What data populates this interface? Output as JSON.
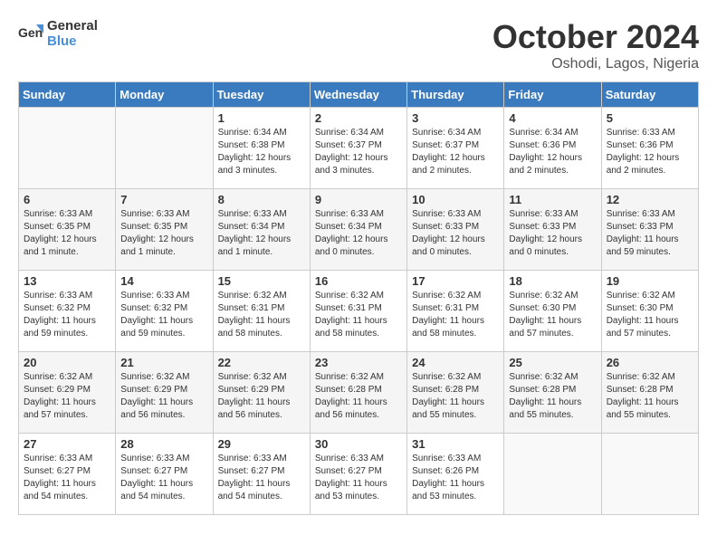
{
  "header": {
    "logo_line1": "General",
    "logo_line2": "Blue",
    "month": "October 2024",
    "location": "Oshodi, Lagos, Nigeria"
  },
  "days_of_week": [
    "Sunday",
    "Monday",
    "Tuesday",
    "Wednesday",
    "Thursday",
    "Friday",
    "Saturday"
  ],
  "weeks": [
    [
      {
        "day": "",
        "info": ""
      },
      {
        "day": "",
        "info": ""
      },
      {
        "day": "1",
        "info": "Sunrise: 6:34 AM\nSunset: 6:38 PM\nDaylight: 12 hours\nand 3 minutes."
      },
      {
        "day": "2",
        "info": "Sunrise: 6:34 AM\nSunset: 6:37 PM\nDaylight: 12 hours\nand 3 minutes."
      },
      {
        "day": "3",
        "info": "Sunrise: 6:34 AM\nSunset: 6:37 PM\nDaylight: 12 hours\nand 2 minutes."
      },
      {
        "day": "4",
        "info": "Sunrise: 6:34 AM\nSunset: 6:36 PM\nDaylight: 12 hours\nand 2 minutes."
      },
      {
        "day": "5",
        "info": "Sunrise: 6:33 AM\nSunset: 6:36 PM\nDaylight: 12 hours\nand 2 minutes."
      }
    ],
    [
      {
        "day": "6",
        "info": "Sunrise: 6:33 AM\nSunset: 6:35 PM\nDaylight: 12 hours\nand 1 minute."
      },
      {
        "day": "7",
        "info": "Sunrise: 6:33 AM\nSunset: 6:35 PM\nDaylight: 12 hours\nand 1 minute."
      },
      {
        "day": "8",
        "info": "Sunrise: 6:33 AM\nSunset: 6:34 PM\nDaylight: 12 hours\nand 1 minute."
      },
      {
        "day": "9",
        "info": "Sunrise: 6:33 AM\nSunset: 6:34 PM\nDaylight: 12 hours\nand 0 minutes."
      },
      {
        "day": "10",
        "info": "Sunrise: 6:33 AM\nSunset: 6:33 PM\nDaylight: 12 hours\nand 0 minutes."
      },
      {
        "day": "11",
        "info": "Sunrise: 6:33 AM\nSunset: 6:33 PM\nDaylight: 12 hours\nand 0 minutes."
      },
      {
        "day": "12",
        "info": "Sunrise: 6:33 AM\nSunset: 6:33 PM\nDaylight: 11 hours\nand 59 minutes."
      }
    ],
    [
      {
        "day": "13",
        "info": "Sunrise: 6:33 AM\nSunset: 6:32 PM\nDaylight: 11 hours\nand 59 minutes."
      },
      {
        "day": "14",
        "info": "Sunrise: 6:33 AM\nSunset: 6:32 PM\nDaylight: 11 hours\nand 59 minutes."
      },
      {
        "day": "15",
        "info": "Sunrise: 6:32 AM\nSunset: 6:31 PM\nDaylight: 11 hours\nand 58 minutes."
      },
      {
        "day": "16",
        "info": "Sunrise: 6:32 AM\nSunset: 6:31 PM\nDaylight: 11 hours\nand 58 minutes."
      },
      {
        "day": "17",
        "info": "Sunrise: 6:32 AM\nSunset: 6:31 PM\nDaylight: 11 hours\nand 58 minutes."
      },
      {
        "day": "18",
        "info": "Sunrise: 6:32 AM\nSunset: 6:30 PM\nDaylight: 11 hours\nand 57 minutes."
      },
      {
        "day": "19",
        "info": "Sunrise: 6:32 AM\nSunset: 6:30 PM\nDaylight: 11 hours\nand 57 minutes."
      }
    ],
    [
      {
        "day": "20",
        "info": "Sunrise: 6:32 AM\nSunset: 6:29 PM\nDaylight: 11 hours\nand 57 minutes."
      },
      {
        "day": "21",
        "info": "Sunrise: 6:32 AM\nSunset: 6:29 PM\nDaylight: 11 hours\nand 56 minutes."
      },
      {
        "day": "22",
        "info": "Sunrise: 6:32 AM\nSunset: 6:29 PM\nDaylight: 11 hours\nand 56 minutes."
      },
      {
        "day": "23",
        "info": "Sunrise: 6:32 AM\nSunset: 6:28 PM\nDaylight: 11 hours\nand 56 minutes."
      },
      {
        "day": "24",
        "info": "Sunrise: 6:32 AM\nSunset: 6:28 PM\nDaylight: 11 hours\nand 55 minutes."
      },
      {
        "day": "25",
        "info": "Sunrise: 6:32 AM\nSunset: 6:28 PM\nDaylight: 11 hours\nand 55 minutes."
      },
      {
        "day": "26",
        "info": "Sunrise: 6:32 AM\nSunset: 6:28 PM\nDaylight: 11 hours\nand 55 minutes."
      }
    ],
    [
      {
        "day": "27",
        "info": "Sunrise: 6:33 AM\nSunset: 6:27 PM\nDaylight: 11 hours\nand 54 minutes."
      },
      {
        "day": "28",
        "info": "Sunrise: 6:33 AM\nSunset: 6:27 PM\nDaylight: 11 hours\nand 54 minutes."
      },
      {
        "day": "29",
        "info": "Sunrise: 6:33 AM\nSunset: 6:27 PM\nDaylight: 11 hours\nand 54 minutes."
      },
      {
        "day": "30",
        "info": "Sunrise: 6:33 AM\nSunset: 6:27 PM\nDaylight: 11 hours\nand 53 minutes."
      },
      {
        "day": "31",
        "info": "Sunrise: 6:33 AM\nSunset: 6:26 PM\nDaylight: 11 hours\nand 53 minutes."
      },
      {
        "day": "",
        "info": ""
      },
      {
        "day": "",
        "info": ""
      }
    ]
  ]
}
